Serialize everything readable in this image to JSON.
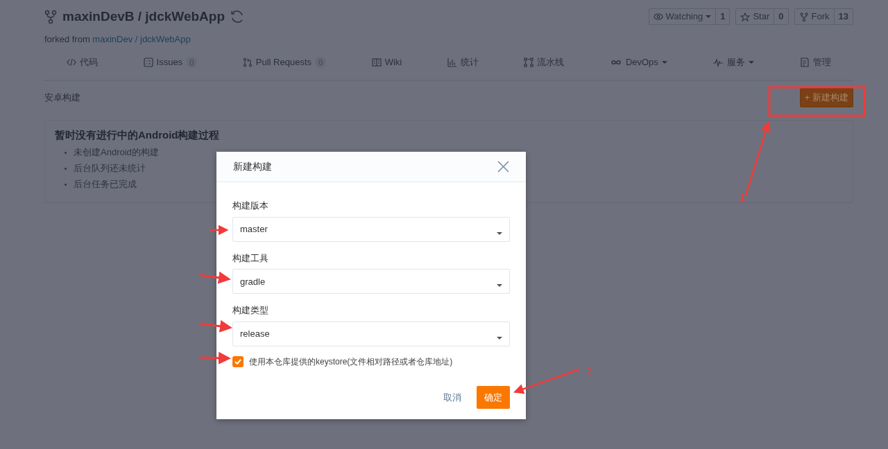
{
  "repo": {
    "owner": "maxinDevB",
    "separator": "/",
    "name": "jdckWebApp",
    "forked_prefix": "forked from",
    "forked_owner": "maxinDev",
    "forked_separator": "/",
    "forked_name": "jdckWebApp"
  },
  "repo_actions": [
    {
      "label": "Watching",
      "count": "1",
      "dropdown": true
    },
    {
      "label": "Star",
      "count": "0",
      "dropdown": false
    },
    {
      "label": "Fork",
      "count": "13",
      "dropdown": false
    }
  ],
  "nav": [
    {
      "label": "代码",
      "dropdown": false
    },
    {
      "label": "Issues",
      "count": "0",
      "dropdown": false
    },
    {
      "label": "Pull Requests",
      "count": "0",
      "dropdown": false
    },
    {
      "label": "Wiki",
      "dropdown": false
    },
    {
      "label": "统计",
      "dropdown": false
    },
    {
      "label": "流水线",
      "dropdown": false
    },
    {
      "label": "DevOps",
      "dropdown": true
    },
    {
      "label": "服务",
      "dropdown": true
    },
    {
      "label": "管理",
      "dropdown": false
    }
  ],
  "section": {
    "title": "安卓构建",
    "new_button": "+ 新建构建"
  },
  "empty_card": {
    "title": "暂时没有进行中的Android构建过程",
    "items": [
      "未创建Android的构建",
      "后台队列还未统计",
      "后台任务已完成"
    ]
  },
  "dialog": {
    "title": "新建构建",
    "fields": [
      {
        "label": "构建版本",
        "value": "master"
      },
      {
        "label": "构建工具",
        "value": "gradle"
      },
      {
        "label": "构建类型",
        "value": "release"
      }
    ],
    "checkbox": {
      "label": "使用本仓库提供的keystore(文件相对路径或者仓库地址)",
      "checked": true
    },
    "cancel": "取消",
    "confirm": "确定"
  },
  "annotations": [
    {
      "label": "1"
    },
    {
      "label": "2"
    }
  ]
}
